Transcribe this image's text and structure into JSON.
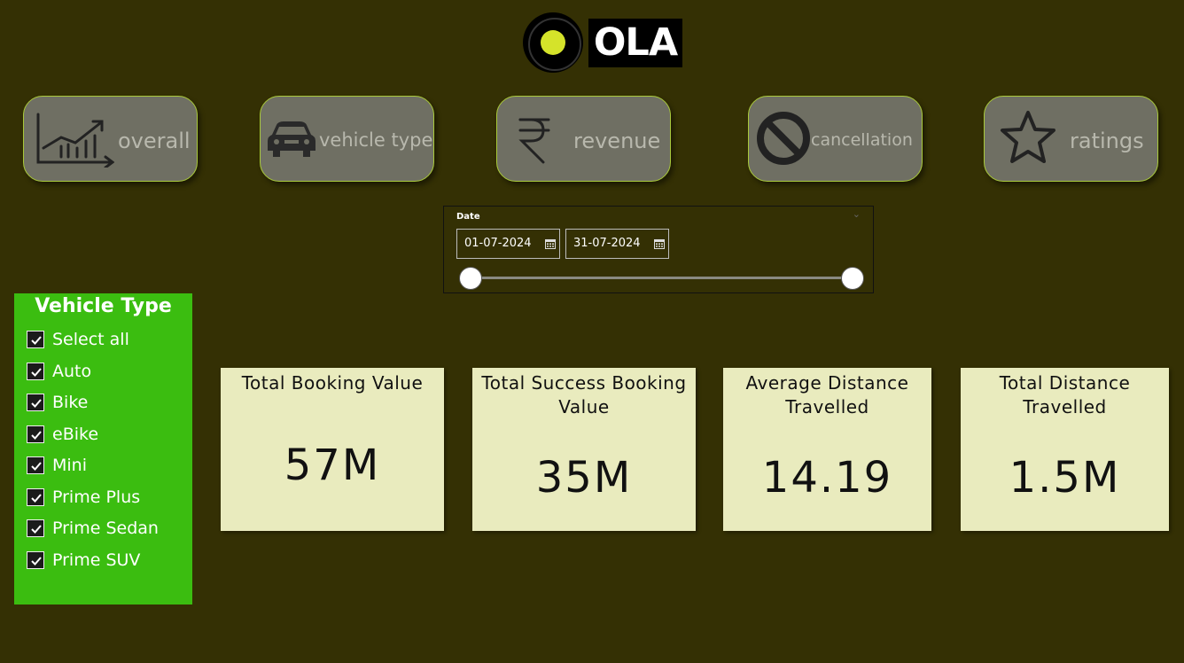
{
  "logo": {
    "text": "OLA"
  },
  "nav": {
    "overall": "overall",
    "vehicle_type": "vehicle type",
    "revenue": "revenue",
    "cancellation": "cancellation",
    "ratings": "ratings"
  },
  "date_slicer": {
    "title": "Date",
    "start": "01-07-2024",
    "end": "31-07-2024"
  },
  "vehicle_filter": {
    "title": "Vehicle Type",
    "items": [
      "Select all",
      "Auto",
      "Bike",
      "eBike",
      "Mini",
      "Prime Plus",
      "Prime Sedan",
      "Prime SUV"
    ]
  },
  "kpis": [
    {
      "title_line1": "Total Booking Value",
      "title_line2": "",
      "value": "57M"
    },
    {
      "title_line1": "Total Success Booking",
      "title_line2": "Value",
      "value": "35M"
    },
    {
      "title_line1": "Average Distance",
      "title_line2": "Travelled",
      "value": "14.19"
    },
    {
      "title_line1": "Total Distance",
      "title_line2": "Travelled",
      "value": "1.5M"
    }
  ],
  "colors": {
    "background": "#343004",
    "filter_panel": "#3bbd10",
    "card": "#e9ebbe",
    "nav_button": "#6f6f63",
    "nav_border": "#a9c93a",
    "logo_accent": "#d5e32a"
  }
}
